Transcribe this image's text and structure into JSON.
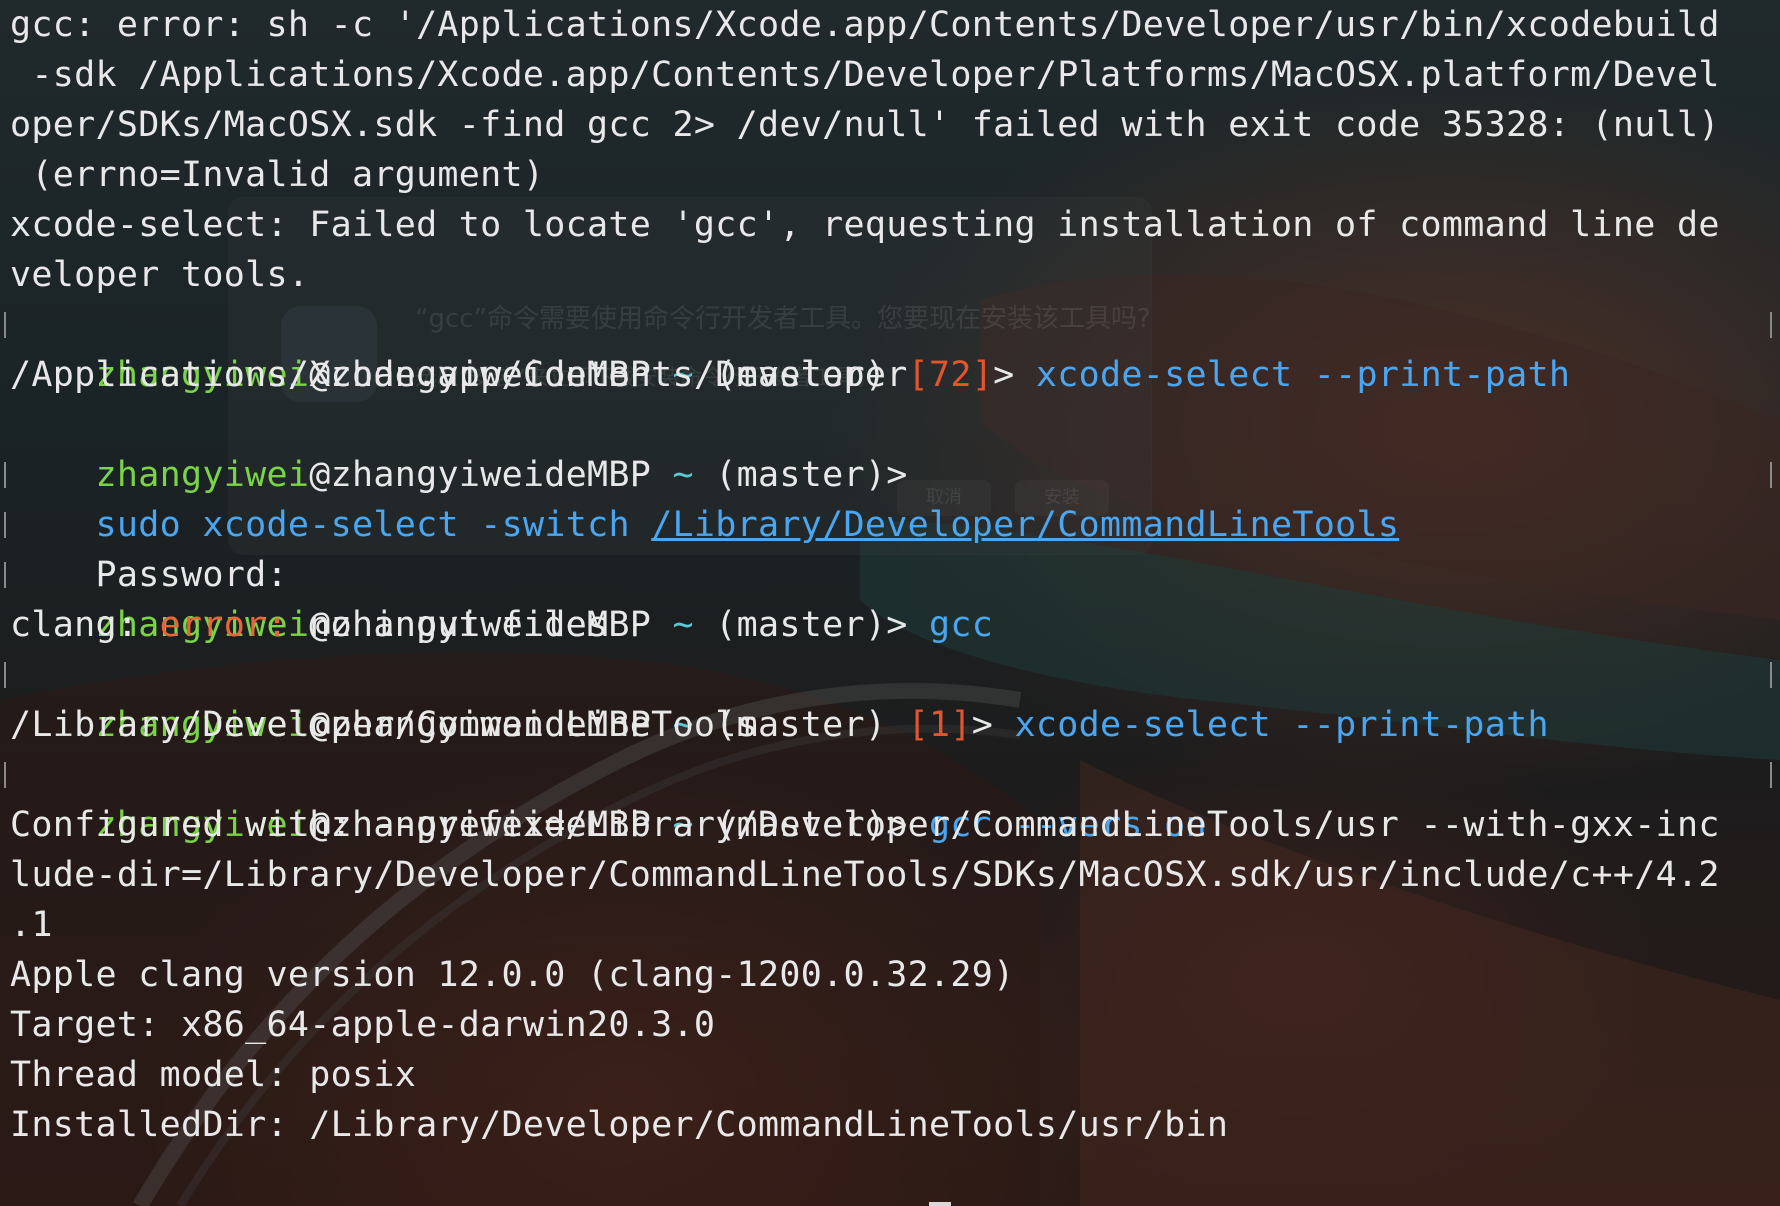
{
  "terminal": {
    "background": "#0f1416",
    "colors": {
      "user": "#7bd348",
      "command": "#4aa6f0",
      "error_number": "#e2552d",
      "error_word": "#e8643a",
      "text": "#e8e8e8"
    },
    "prompt": {
      "user": "zhangyiwei",
      "at": "@",
      "host": "zhangyiweideMBP",
      "tilde": "~",
      "branch": "(master)",
      "gt": ">"
    },
    "lines": {
      "l1": "gcc: error: sh -c '/Applications/Xcode.app/Contents/Developer/usr/bin/xcodebuild",
      "l2": " -sdk /Applications/Xcode.app/Contents/Developer/Platforms/MacOSX.platform/Devel",
      "l3": "oper/SDKs/MacOSX.sdk -find gcc 2> /dev/null' failed with exit code 35328: (null)",
      "l4": " (errno=Invalid argument)",
      "l5": "xcode-select: Failed to locate 'gcc', requesting installation of command line de",
      "l6": "veloper tools.",
      "l7_status": "[72]",
      "l7_cmd": "xcode-select --print-path",
      "l8": "/Applications/Xcode.app/Contents/Developer",
      "l10_sudo": "sudo",
      "l10_cmd": "xcode-select -switch",
      "l10_path": "/Library/Developer/CommandLineTools",
      "l11": "Password:",
      "l12_cmd": "gcc",
      "l13_pre": "clang: ",
      "l13_err": "error:",
      "l13_post": " no input files",
      "l14_status": "[1]",
      "l14_cmd": "xcode-select --print-path",
      "l15": "/Library/Developer/CommandLineTools",
      "l16_cmd": "gcc --version",
      "l17": "Configured with: --prefix=/Library/Developer/CommandLineTools/usr --with-gxx-inc",
      "l18": "lude-dir=/Library/Developer/CommandLineTools/SDKs/MacOSX.sdk/usr/include/c++/4.2",
      "l19": ".1",
      "l20": "Apple clang version 12.0.0 (clang-1200.0.32.29)",
      "l21": "Target: x86_64-apple-darwin20.3.0",
      "l22": "Thread model: posix",
      "l23": "InstalledDir: /Library/Developer/CommandLineTools/usr/bin"
    }
  },
  "ghost_dialog": {
    "line1": "“gcc”命令需要使用命令行开发者工具。您要现在安装该工具吗?",
    "line2": "选取“安装”来立即下载安装命令行开发者工具。",
    "cancel": "取消",
    "install": "安装"
  }
}
